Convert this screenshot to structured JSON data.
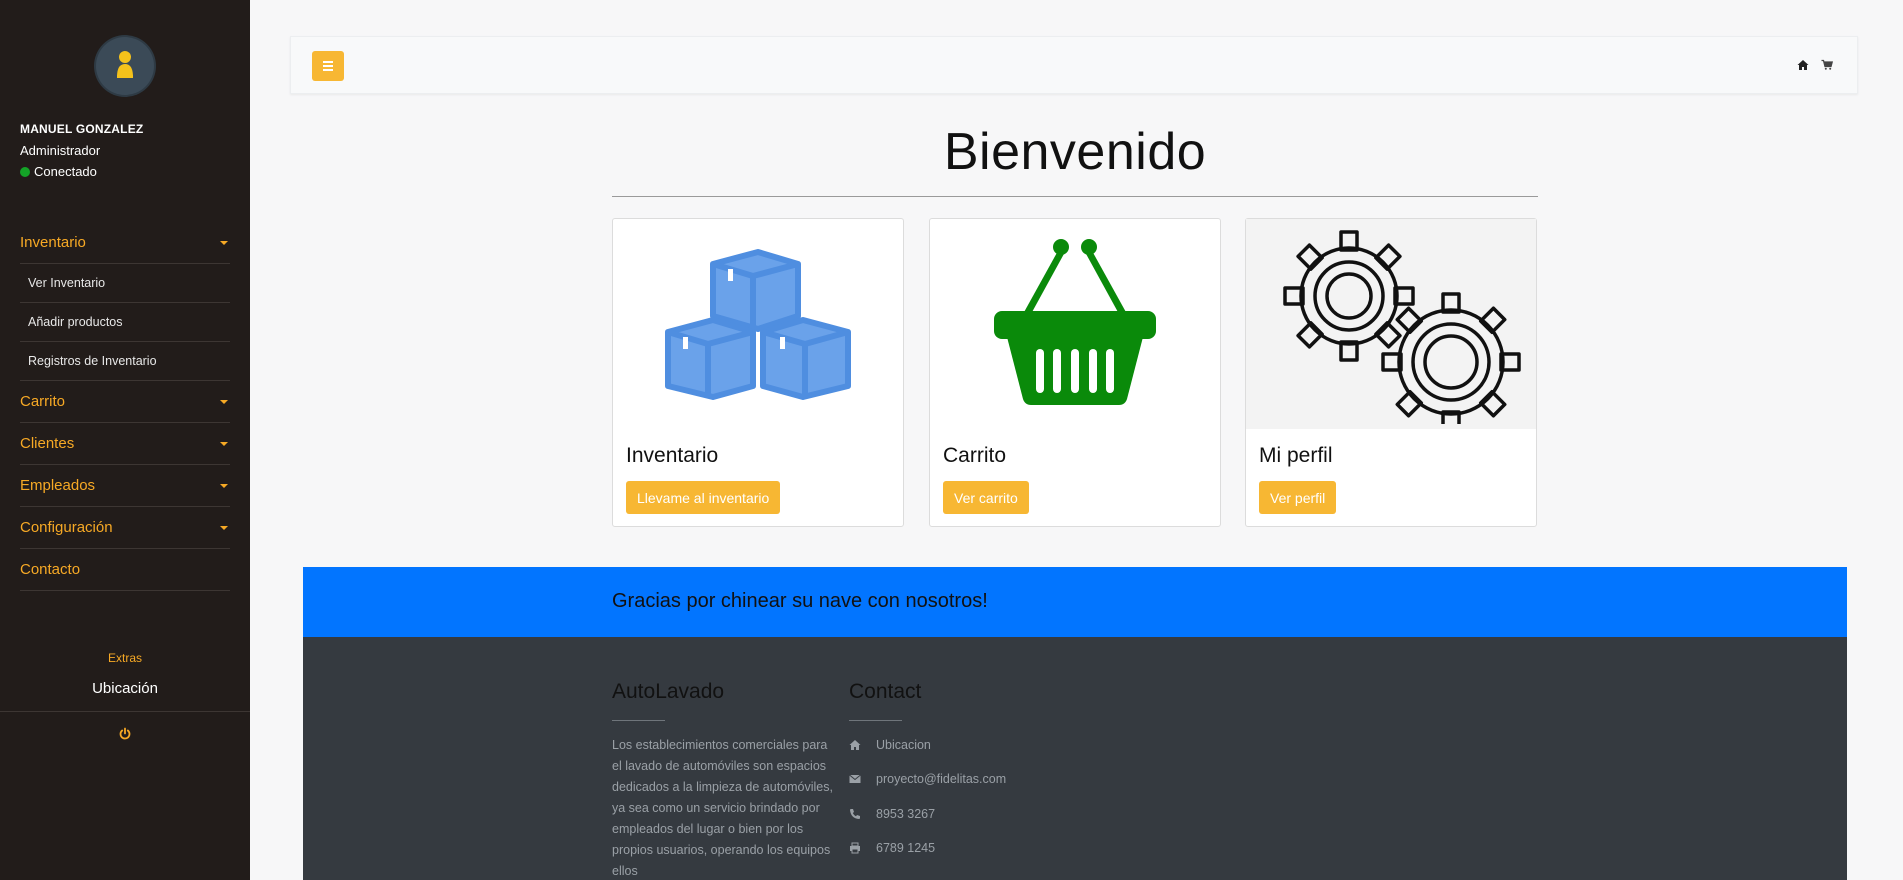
{
  "sidebar": {
    "user_name": "MANUEL GONZALEZ",
    "user_role": "Administrador",
    "status": "Conectado",
    "menu": {
      "inventario": "Inventario",
      "ver_inventario": "Ver Inventario",
      "anadir_productos": "Añadir productos",
      "registros": "Registros de Inventario",
      "carrito": "Carrito",
      "clientes": "Clientes",
      "empleados": "Empleados",
      "configuracion": "Configuración",
      "contacto": "Contacto"
    },
    "extras_label": "Extras",
    "ubicacion": "Ubicación"
  },
  "navbar": {
    "icons": [
      "home-icon",
      "cart-icon"
    ]
  },
  "main": {
    "title": "Bienvenido",
    "cards": [
      {
        "title": "Inventario",
        "button": "Llevame al inventario",
        "icon": "boxes-icon"
      },
      {
        "title": "Carrito",
        "button": "Ver carrito",
        "icon": "basket-icon"
      },
      {
        "title": "Mi perfil",
        "button": "Ver perfil",
        "icon": "gears-icon"
      }
    ]
  },
  "footer": {
    "banner_text": "Gracias por chinear su nave con nosotros!",
    "about_title": "AutoLavado",
    "about_text": "Los establecimientos comerciales para el lavado de automóviles son espacios dedicados a la limpieza de automóviles, ya sea como un servicio brindado por empleados del lugar o bien por los propios usuarios, operando los equipos ellos",
    "contact_title": "Contact",
    "contact": {
      "location": "Ubicacion",
      "email": "proyecto@fidelitas.com",
      "phone": "8953 3267",
      "fax": "6789 1245"
    }
  },
  "colors": {
    "sidebar_bg": "#221c1a",
    "accent": "#f7b733",
    "menu_text": "#f7a925",
    "banner": "#0275ff",
    "footer_bg": "#353a40",
    "status_online": "#14a327"
  }
}
